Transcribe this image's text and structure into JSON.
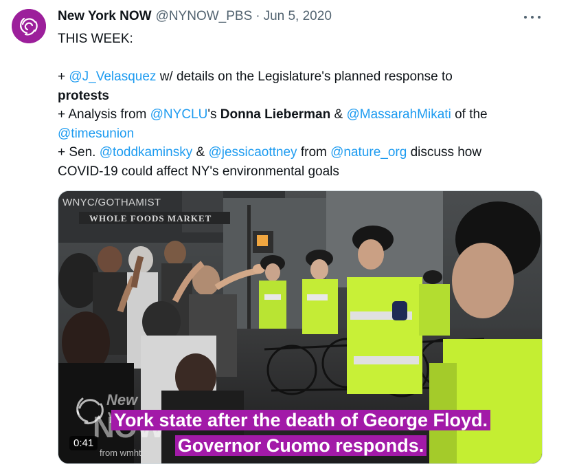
{
  "author": {
    "name": "New York NOW",
    "handle": "@NYNOW_PBS",
    "separator": "·",
    "date": "Jun 5, 2020",
    "avatar_color": "#9c1f9b"
  },
  "tweet": {
    "line1": "THIS WEEK:",
    "line3": {
      "prefix": "+ ",
      "mention1": "@J_Velasquez",
      "text1": " w/ details on the Legislature's planned response to"
    },
    "line4": {
      "bold": "protests"
    },
    "line5": {
      "prefix": "+ Analysis from ",
      "mention1": "@NYCLU",
      "text1": "'s ",
      "bold": "Donna Lieberman",
      "text2": " & ",
      "mention2": "@MassarahMikati",
      "text3": " of the"
    },
    "line6": {
      "mention1": "@timesunion"
    },
    "line7": {
      "prefix": "+ Sen. ",
      "mention1": "@toddkaminsky",
      "text1": " & ",
      "mention2": "@jessicaottney",
      "text2": " from ",
      "mention3": "@nature_org",
      "text3": " discuss how"
    },
    "line8": {
      "text": "COVID-19 could affect NY's environmental goals"
    }
  },
  "media": {
    "watermark": "WNYC/GOTHAMIST",
    "storefront": "WHOLE FOODS MARKET",
    "caption_line1": "York state after the death of George Floyd.",
    "caption_line2": "Governor Cuomo responds.",
    "timestamp": "0:41",
    "logo_top": "New York",
    "logo_main": "NOW",
    "logo_from": "from wmht",
    "caption_bg": "#a21aa8"
  },
  "colors": {
    "mention": "#1d9bf0",
    "text": "#0f1419",
    "secondary": "#536471"
  },
  "icons": {
    "more": "more-horizontal-icon",
    "avatar_logo": "swirl-logo-icon",
    "police_badge": "police-patch-icon"
  }
}
